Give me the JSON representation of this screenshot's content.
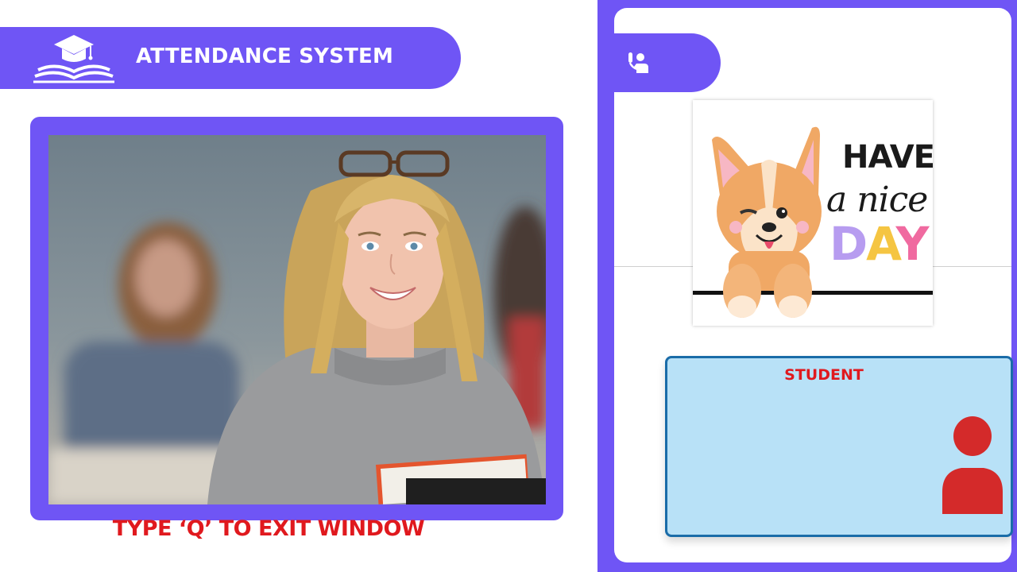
{
  "header": {
    "title": "ATTENDANCE SYSTEM",
    "logo_icon": "graduation-cap-book-icon"
  },
  "camera": {
    "exit_hint": "TYPE ‘Q’ TO EXIT WINDOW"
  },
  "panel": {
    "tab_icon": "raised-hand-person-icon",
    "greeting": {
      "line1": "HAVE",
      "line2": "a nice",
      "line3_letters": [
        "D",
        "A",
        "Y"
      ]
    },
    "student_card": {
      "label": "STUDENT",
      "avatar_icon": "person-silhouette-icon"
    }
  },
  "colors": {
    "accent": "#6f55f5",
    "alert_red": "#e0191e",
    "card_fill": "#b8e1f7",
    "card_border": "#1a6ca8",
    "day_colors": [
      "#b79cf0",
      "#f5c542",
      "#f06aa0"
    ]
  }
}
